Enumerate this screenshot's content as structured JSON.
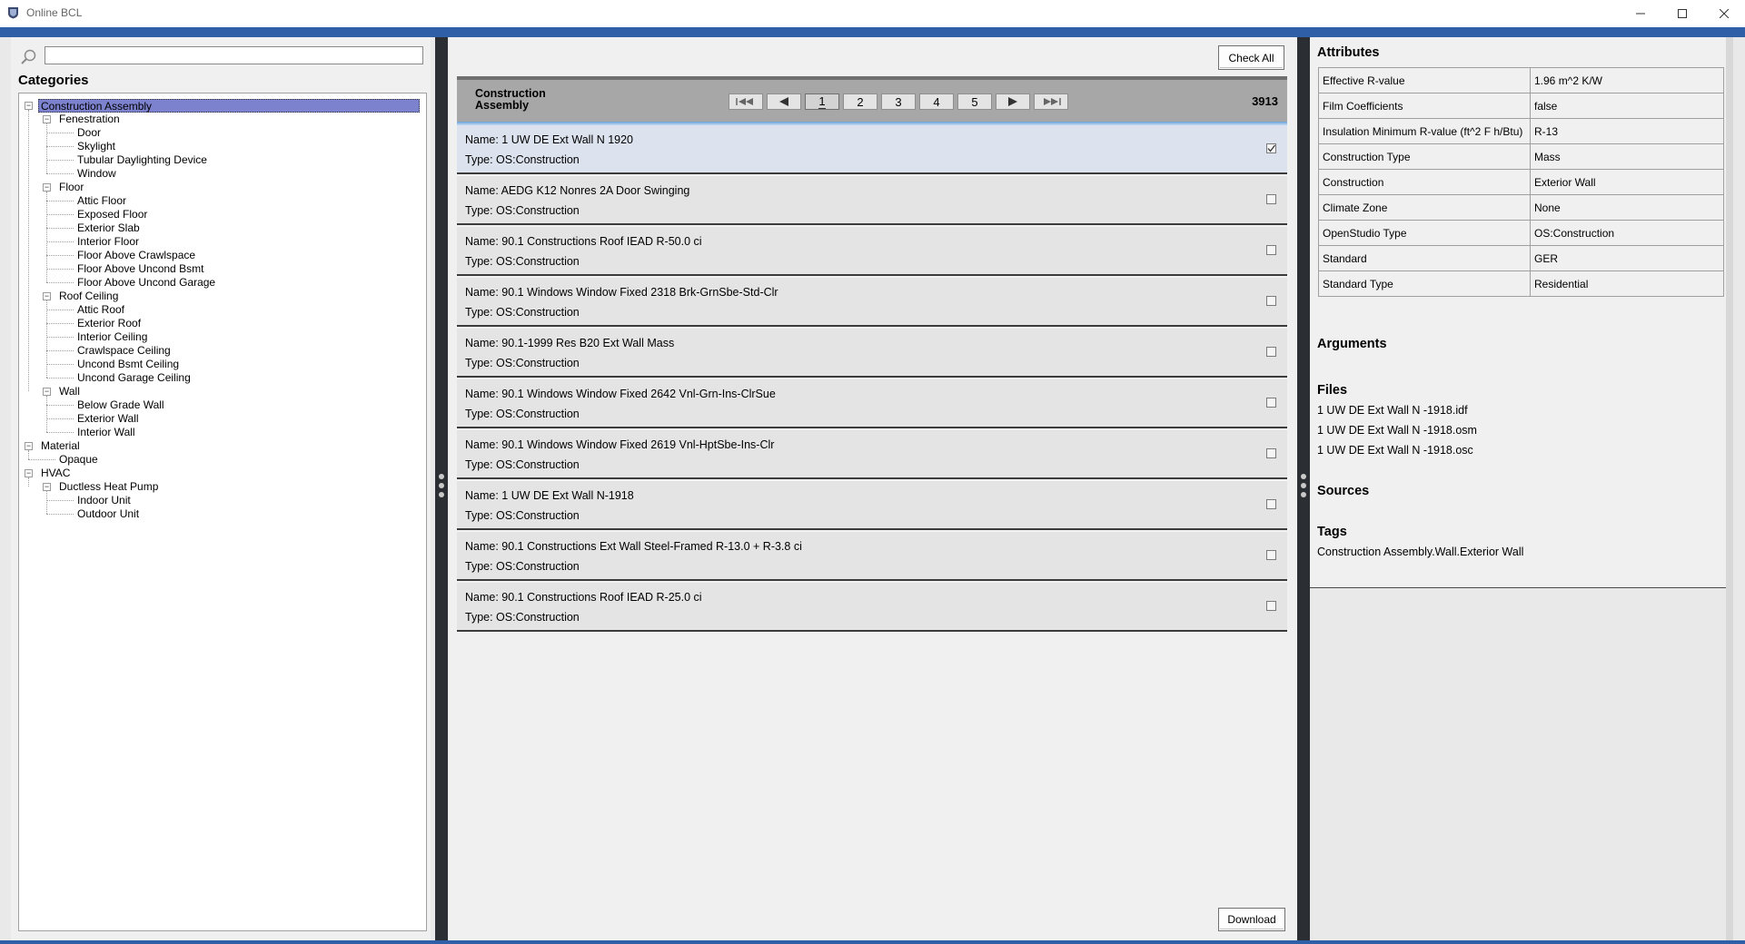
{
  "window": {
    "title": "Online BCL"
  },
  "search": {
    "placeholder": "",
    "value": ""
  },
  "categories": {
    "title": "Categories",
    "items": [
      {
        "label": "Construction Assembly",
        "level": 0,
        "expander": "−",
        "selected": true
      },
      {
        "label": "Fenestration",
        "level": 1,
        "expander": "−"
      },
      {
        "label": "Door",
        "level": 2
      },
      {
        "label": "Skylight",
        "level": 2
      },
      {
        "label": "Tubular Daylighting Device",
        "level": 2
      },
      {
        "label": "Window",
        "level": 2
      },
      {
        "label": "Floor",
        "level": 1,
        "expander": "−"
      },
      {
        "label": "Attic Floor",
        "level": 2
      },
      {
        "label": "Exposed Floor",
        "level": 2
      },
      {
        "label": "Exterior Slab",
        "level": 2
      },
      {
        "label": "Interior Floor",
        "level": 2
      },
      {
        "label": "Floor Above Crawlspace",
        "level": 2
      },
      {
        "label": "Floor Above Uncond Bsmt",
        "level": 2
      },
      {
        "label": "Floor Above Uncond Garage",
        "level": 2
      },
      {
        "label": "Roof Ceiling",
        "level": 1,
        "expander": "−"
      },
      {
        "label": "Attic Roof",
        "level": 2
      },
      {
        "label": "Exterior Roof",
        "level": 2
      },
      {
        "label": "Interior Ceiling",
        "level": 2
      },
      {
        "label": "Crawlspace Ceiling",
        "level": 2
      },
      {
        "label": "Uncond Bsmt Ceiling",
        "level": 2
      },
      {
        "label": "Uncond Garage Ceiling",
        "level": 2
      },
      {
        "label": "Wall",
        "level": 1,
        "expander": "−"
      },
      {
        "label": "Below Grade Wall",
        "level": 2
      },
      {
        "label": "Exterior Wall",
        "level": 2
      },
      {
        "label": "Interior Wall",
        "level": 2
      },
      {
        "label": "Material",
        "level": 0,
        "expander": "−"
      },
      {
        "label": "Opaque",
        "level": 1
      },
      {
        "label": "HVAC",
        "level": 0,
        "expander": "−"
      },
      {
        "label": "Ductless Heat Pump",
        "level": 1,
        "expander": "−"
      },
      {
        "label": "Indoor Unit",
        "level": 2
      },
      {
        "label": "Outdoor Unit",
        "level": 2
      }
    ]
  },
  "toolbar": {
    "check_all_label": "Check All",
    "download_label": "Download"
  },
  "results_header": {
    "title": "Construction Assembly",
    "count": "3913",
    "pages": [
      "1",
      "2",
      "3",
      "4",
      "5"
    ],
    "active_page": "1",
    "nav_icons": [
      "first-page-icon",
      "prev-page-icon",
      "next-page-icon",
      "last-page-icon"
    ]
  },
  "results": [
    {
      "name": "Name: 1 UW DE Ext Wall N 1920",
      "type": "Type: OS:Construction",
      "checked": true
    },
    {
      "name": "Name: AEDG K12 Nonres 2A Door Swinging",
      "type": "Type: OS:Construction",
      "checked": false
    },
    {
      "name": "Name: 90.1 Constructions Roof IEAD R-50.0 ci",
      "type": "Type: OS:Construction",
      "checked": false
    },
    {
      "name": "Name: 90.1 Windows Window Fixed 2318 Brk-GrnSbe-Std-Clr",
      "type": "Type: OS:Construction",
      "checked": false
    },
    {
      "name": "Name: 90.1-1999 Res B20 Ext Wall Mass",
      "type": "Type: OS:Construction",
      "checked": false
    },
    {
      "name": "Name: 90.1 Windows Window Fixed 2642 Vnl-Grn-Ins-ClrSue",
      "type": "Type: OS:Construction",
      "checked": false
    },
    {
      "name": "Name: 90.1 Windows Window Fixed 2619 Vnl-HptSbe-Ins-Clr",
      "type": "Type: OS:Construction",
      "checked": false
    },
    {
      "name": "Name: 1 UW DE Ext Wall N-1918",
      "type": "Type: OS:Construction",
      "checked": false
    },
    {
      "name": "Name: 90.1 Constructions Ext Wall Steel-Framed R-13.0 + R-3.8 ci",
      "type": "Type: OS:Construction",
      "checked": false
    },
    {
      "name": "Name: 90.1 Constructions Roof IEAD R-25.0 ci",
      "type": "Type: OS:Construction",
      "checked": false
    }
  ],
  "details": {
    "attributes_title": "Attributes",
    "attributes": [
      {
        "key": "Effective R-value",
        "value": "1.96 m^2 K/W"
      },
      {
        "key": "Film Coefficients",
        "value": "false"
      },
      {
        "key": "Insulation Minimum R-value (ft^2 F h/Btu)",
        "value": "R-13"
      },
      {
        "key": "Construction Type",
        "value": "Mass"
      },
      {
        "key": "Construction",
        "value": "Exterior Wall"
      },
      {
        "key": "Climate Zone",
        "value": "None"
      },
      {
        "key": "OpenStudio Type",
        "value": "OS:Construction"
      },
      {
        "key": "Standard",
        "value": "GER"
      },
      {
        "key": "Standard Type",
        "value": "Residential"
      }
    ],
    "arguments_title": "Arguments",
    "files_title": "Files",
    "files": [
      "1 UW DE Ext Wall N -1918.idf",
      "1 UW DE Ext Wall N -1918.osm",
      "1 UW DE Ext Wall N -1918.osc"
    ],
    "sources_title": "Sources",
    "tags_title": "Tags",
    "tags": "Construction Assembly.Wall.Exterior Wall"
  },
  "colors": {
    "accent": "#2f5fa7",
    "selection": "#7c82ce",
    "splitter": "#2b2f33",
    "header": "#a7a7a7"
  }
}
